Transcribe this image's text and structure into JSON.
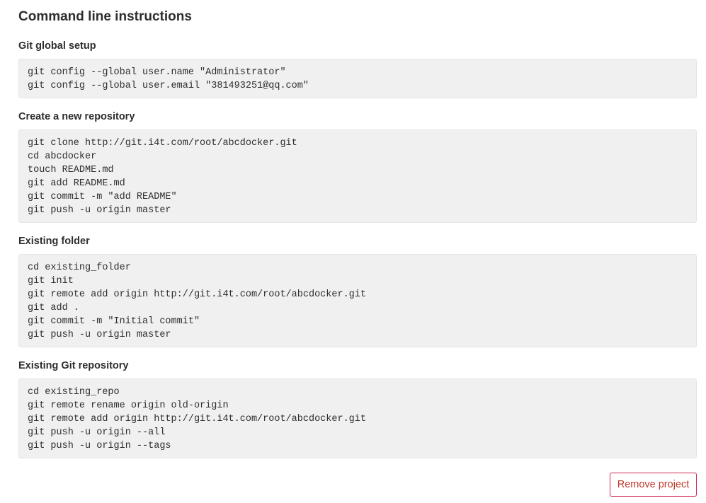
{
  "page": {
    "title": "Command line instructions"
  },
  "sections": [
    {
      "heading": "Git global setup",
      "lines": [
        "git config --global user.name \"Administrator\"",
        "git config --global user.email \"381493251@qq.com\""
      ]
    },
    {
      "heading": "Create a new repository",
      "lines": [
        "git clone http://git.i4t.com/root/abcdocker.git",
        "cd abcdocker",
        "touch README.md",
        "git add README.md",
        "git commit -m \"add README\"",
        "git push -u origin master"
      ]
    },
    {
      "heading": "Existing folder",
      "lines": [
        "cd existing_folder",
        "git init",
        "git remote add origin http://git.i4t.com/root/abcdocker.git",
        "git add .",
        "git commit -m \"Initial commit\"",
        "git push -u origin master"
      ]
    },
    {
      "heading": "Existing Git repository",
      "lines": [
        "cd existing_repo",
        "git remote rename origin old-origin",
        "git remote add origin http://git.i4t.com/root/abcdocker.git",
        "git push -u origin --all",
        "git push -u origin --tags"
      ]
    }
  ],
  "actions": {
    "remove_project_label": "Remove project"
  },
  "colors": {
    "code_background": "#f0f0f0",
    "danger": "#d22852"
  }
}
